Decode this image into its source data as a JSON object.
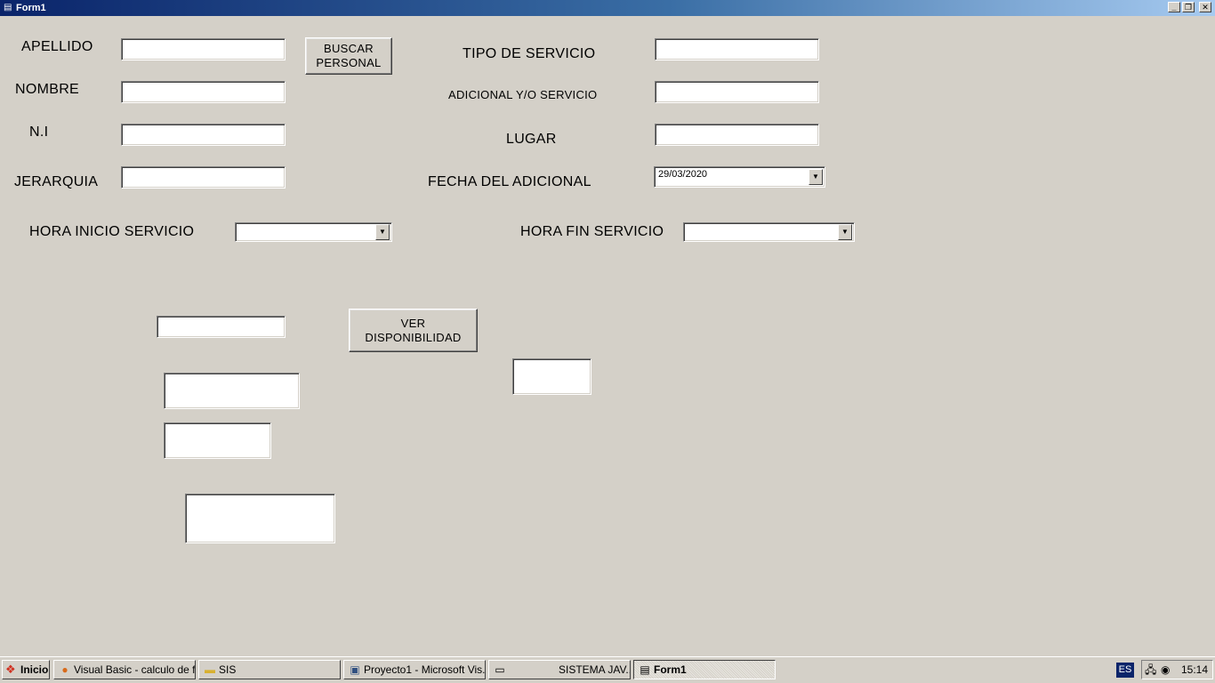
{
  "window": {
    "title": "Form1"
  },
  "labels": {
    "apellido": "APELLIDO",
    "nombre": "NOMBRE",
    "ni": "N.I",
    "jerarquia": "JERARQUIA",
    "tipo_servicio": "TIPO DE SERVICIO",
    "adicional_servicio": "ADICIONAL Y/O SERVICIO",
    "lugar": "LUGAR",
    "fecha_adicional": "FECHA DEL ADICIONAL",
    "hora_inicio": "HORA INICIO SERVICIO",
    "hora_fin": "HORA FIN SERVICIO"
  },
  "buttons": {
    "buscar_personal": [
      "BUSCAR",
      "PERSONAL"
    ],
    "ver_disponibilidad": [
      "VER",
      "DISPONIBILIDAD"
    ]
  },
  "fields": {
    "fecha_adicional_value": "29/03/2020"
  },
  "taskbar": {
    "start_label": "Inicio",
    "tasks": [
      {
        "label": "Visual Basic - calculo de f...",
        "icon": "firefox-icon"
      },
      {
        "label": "SIS",
        "icon": "folder-icon"
      },
      {
        "label": "Proyecto1 - Microsoft Vis...",
        "icon": "vb-icon"
      },
      {
        "label": "SISTEMA JAV...",
        "icon": "window-icon"
      },
      {
        "label": "Form1",
        "icon": "form-icon"
      }
    ],
    "language": "ES",
    "clock": "15:14"
  }
}
